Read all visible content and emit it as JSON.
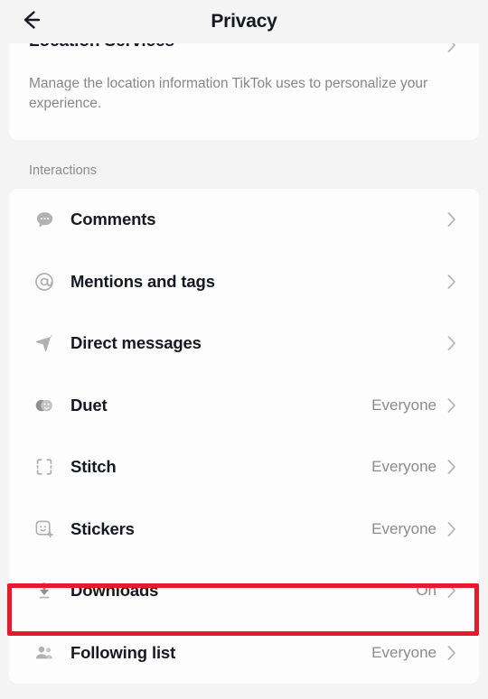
{
  "header": {
    "title": "Privacy",
    "back_icon": "arrow-left-icon"
  },
  "top_card": {
    "title": "Location Services",
    "description": "Manage the location information TikTok uses to personalize your experience.",
    "chevron_icon": "chevron-right-icon"
  },
  "sections": [
    {
      "label": "Interactions",
      "items": [
        {
          "icon": "comment-bubble-icon",
          "label": "Comments",
          "value": ""
        },
        {
          "icon": "at-mention-icon",
          "label": "Mentions and tags",
          "value": ""
        },
        {
          "icon": "paper-plane-icon",
          "label": "Direct messages",
          "value": ""
        },
        {
          "icon": "duet-circles-icon",
          "label": "Duet",
          "value": "Everyone"
        },
        {
          "icon": "stitch-brackets-icon",
          "label": "Stitch",
          "value": "Everyone"
        },
        {
          "icon": "sticker-smiley-icon",
          "label": "Stickers",
          "value": "Everyone"
        },
        {
          "icon": "download-arrow-icon",
          "label": "Downloads",
          "value": "On"
        },
        {
          "icon": "people-group-icon",
          "label": "Following list",
          "value": "Everyone"
        }
      ]
    }
  ],
  "annotation": {
    "highlight_target": "Downloads",
    "color": "#e8192c"
  },
  "colors": {
    "page_background": "#f4f4f4",
    "card_background": "#fdfdfd",
    "primary_text": "#161823",
    "secondary_text": "#8a8b8f",
    "highlight": "#e8192c"
  }
}
